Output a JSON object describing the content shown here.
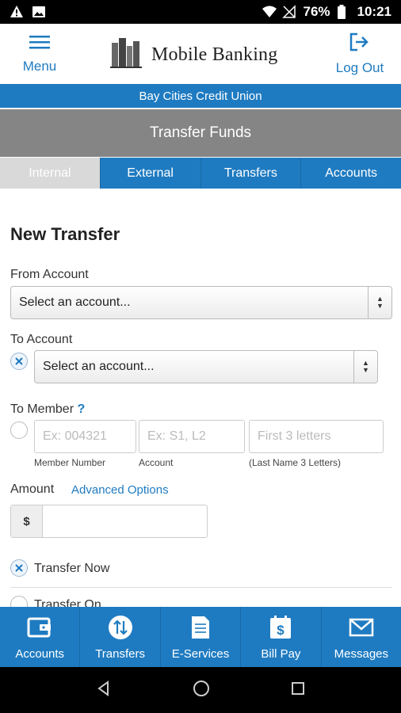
{
  "status_bar": {
    "battery": "76%",
    "time": "10:21"
  },
  "header": {
    "menu_label": "Menu",
    "logo_text": "Mobile Banking",
    "logout_label": "Log Out"
  },
  "credit_union_name": "Bay Cities Credit Union",
  "page_title": "Transfer Funds",
  "tabs": [
    {
      "label": "Internal",
      "active": true
    },
    {
      "label": "External",
      "active": false
    },
    {
      "label": "Transfers",
      "active": false
    },
    {
      "label": "Accounts",
      "active": false
    }
  ],
  "form": {
    "heading": "New Transfer",
    "from_account": {
      "label": "From Account",
      "value": "Select an account..."
    },
    "to_account": {
      "label": "To Account",
      "value": "Select an account..."
    },
    "to_member": {
      "label": "To Member",
      "help": "?",
      "member_number_placeholder": "Ex: 004321",
      "member_number_label": "Member Number",
      "account_placeholder": "Ex: S1, L2",
      "account_label": "Account",
      "last_name_placeholder": "First  3  letters",
      "last_name_label": "(Last Name  3  Letters)"
    },
    "amount": {
      "label": "Amount",
      "advanced_options": "Advanced Options",
      "currency_symbol": "$",
      "value": ""
    },
    "timing": {
      "transfer_now": "Transfer Now",
      "transfer_on": "Transfer On"
    }
  },
  "bottom_nav": [
    {
      "label": "Accounts",
      "icon": "wallet-icon"
    },
    {
      "label": "Transfers",
      "icon": "transfer-arrows-icon"
    },
    {
      "label": "E-Services",
      "icon": "document-icon"
    },
    {
      "label": "Bill Pay",
      "icon": "bill-dollar-icon"
    },
    {
      "label": "Messages",
      "icon": "envelope-icon"
    }
  ],
  "colors": {
    "primary": "#1f7bc1",
    "title_bar": "#858585",
    "tab_active": "#d9d9d9"
  }
}
